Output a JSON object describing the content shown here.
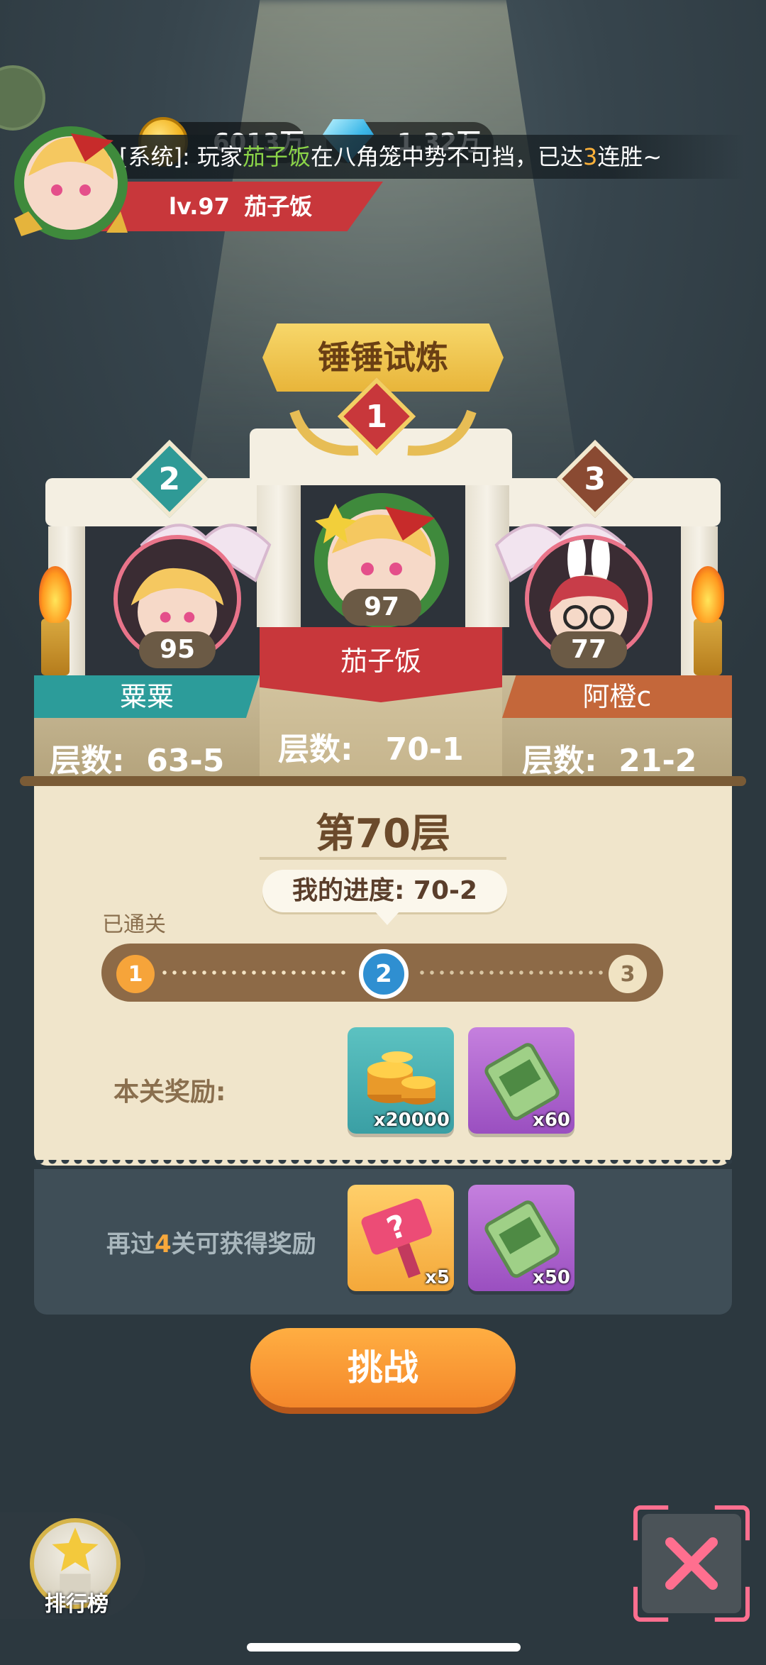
{
  "header": {
    "coins": "6013万",
    "gems": "1.32万",
    "system_message": {
      "prefix": "[系统]: 玩家",
      "player": "茄子饭",
      "middle": "在八角笼中势不可挡，已达",
      "count": "3",
      "suffix": "连胜~"
    },
    "level": "lv.97",
    "player_name": "茄子饭"
  },
  "event": {
    "title": "锤锤试炼"
  },
  "podium": {
    "first": {
      "rank": "1",
      "level": "97",
      "name": "茄子饭",
      "floor_label": "层数:",
      "floor_value": "70-1"
    },
    "second": {
      "rank": "2",
      "level": "95",
      "name": "粟粟",
      "floor_label": "层数:",
      "floor_value": "63-5"
    },
    "third": {
      "rank": "3",
      "level": "77",
      "name": "阿橙c",
      "floor_label": "层数:",
      "floor_value": "21-2"
    }
  },
  "stage": {
    "title": "第70层",
    "progress_label": "我的进度:",
    "progress_value": "70-2",
    "passed_label": "已通关",
    "nodes": [
      "1",
      "2",
      "3"
    ],
    "current_node": "2",
    "reward_label": "本关奖励:",
    "rewards": [
      {
        "icon": "coin-stack-icon",
        "count": "x20000"
      },
      {
        "icon": "scroll-ticket-icon",
        "count": "x60"
      }
    ]
  },
  "bonus": {
    "text_prefix": "再过",
    "text_count": "4",
    "text_suffix": "关可获得奖励",
    "rewards": [
      {
        "icon": "mystery-hammer-icon",
        "count": "x5"
      },
      {
        "icon": "scroll-ticket-icon",
        "count": "x50"
      }
    ]
  },
  "actions": {
    "challenge": "挑战",
    "leaderboard": "排行榜"
  },
  "colors": {
    "accent_orange": "#f4872a",
    "teal": "#3a9fa4",
    "crimson": "#c8373b",
    "rust": "#c4673a"
  }
}
